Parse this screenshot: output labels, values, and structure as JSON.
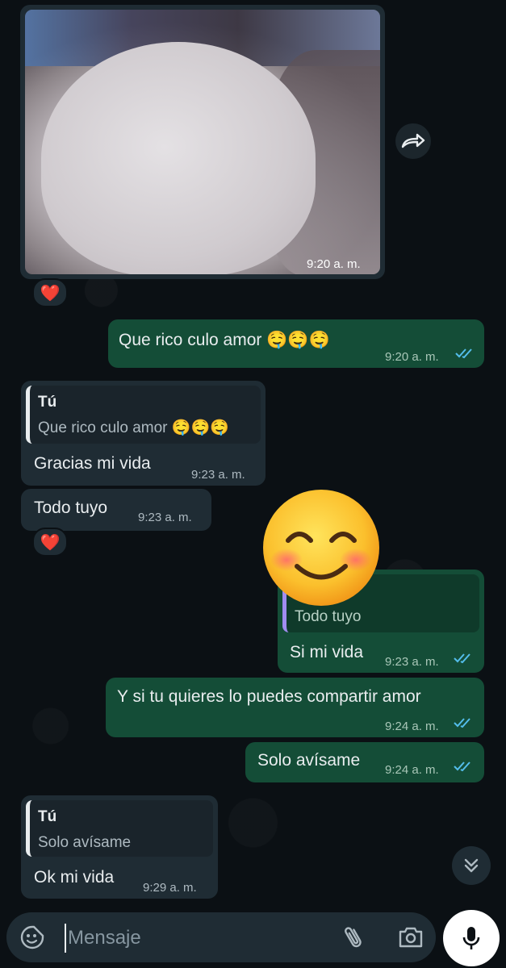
{
  "messages": {
    "photo": {
      "time": "9:20 a. m.",
      "reaction": "❤️"
    },
    "m1": {
      "text": "Que rico culo amor 🤤🤤🤤",
      "time": "9:20 a. m."
    },
    "m2": {
      "quote_author": "Tú",
      "quote_text": "Que rico culo amor 🤤🤤🤤",
      "text": "Gracias mi vida",
      "time": "9:23 a. m."
    },
    "m3": {
      "text": "Todo tuyo",
      "time": "9:23 a. m.",
      "reaction": "❤️"
    },
    "m4": {
      "quote_text": "Todo tuyo",
      "text": "Si mi vida",
      "time": "9:23 a. m."
    },
    "m5": {
      "text": "Y si tu quieres lo puedes compartir amor",
      "time": "9:24 a. m."
    },
    "m6": {
      "text": "Solo avísame",
      "time": "9:24 a. m."
    },
    "m7": {
      "quote_author": "Tú",
      "quote_text": "Solo avísame",
      "text": "Ok mi vida",
      "time": "9:29 a. m."
    }
  },
  "composer": {
    "placeholder": "Mensaje"
  },
  "icons": {
    "emoji": "sticker-icon",
    "attach": "paperclip-icon",
    "camera": "camera-icon",
    "mic": "microphone-icon",
    "forward": "forward-icon",
    "scroll": "double-chevron-down-icon",
    "read": "double-check-icon"
  },
  "colors": {
    "incoming": "#1f2c34",
    "outgoing": "#144d37",
    "read_ticks": "#53bdeb",
    "background": "#0b1014"
  }
}
